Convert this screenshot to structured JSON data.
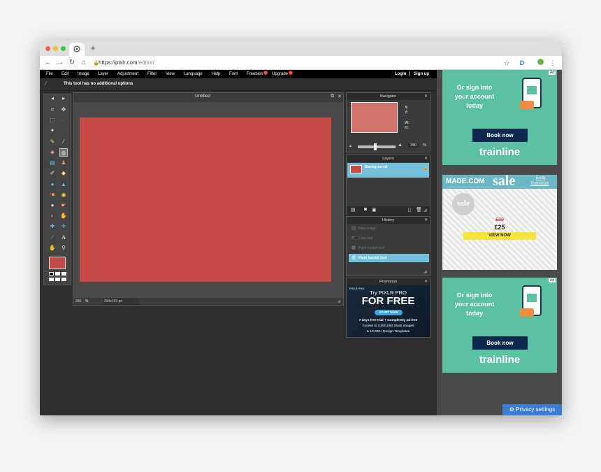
{
  "browser": {
    "url_host": "https://pixlr.com",
    "url_path": "/editor/",
    "new_tab_symbol": "+",
    "icons": [
      "back-icon",
      "forward-icon",
      "reload-icon",
      "home-icon",
      "lock-icon",
      "star-icon",
      "profile-icon",
      "menu-icon"
    ]
  },
  "menu": {
    "items": [
      "File",
      "Edit",
      "Image",
      "Layer",
      "Adjustment",
      "Filter",
      "View",
      "Language",
      "Help",
      "Font",
      "Freebies",
      "Upgrade"
    ],
    "freebies_badge": "1",
    "upgrade_badge": "1",
    "login": "Login",
    "signup": "Sign up",
    "separator": "|"
  },
  "options": {
    "message": "This tool has no additional options"
  },
  "document": {
    "title": "Untitled",
    "zoom": "280",
    "zoom_unit": "%",
    "size": "234x153 px",
    "canvas_color": "#c64a46"
  },
  "navigator": {
    "title": "Navigator",
    "x_label": "X:",
    "y_label": "Y:",
    "w_label": "W:",
    "h_label": "H:",
    "zoom": "280",
    "zoom_unit": "%"
  },
  "layers": {
    "title": "Layers",
    "items": [
      {
        "name": "Background"
      }
    ]
  },
  "history": {
    "title": "History",
    "items": [
      "New image",
      "Crop tool",
      "Paint bucket tool",
      "Paint bucket tool"
    ],
    "active_index": 3
  },
  "promotion": {
    "title": "Promotion",
    "brand": "PIXLR PRO",
    "line1": "Try PIXLR PRO",
    "line2": "FOR FREE",
    "button": "START NOW",
    "line3": "7 days free trial + Completely ad-free",
    "line4": "Access to 3,000,000 Stock Images",
    "line5": "& 10,000+ Design Templates"
  },
  "ads": {
    "trainline_top": {
      "text1": "Or sign into",
      "text2": "your account",
      "text3": "today",
      "button": "Book now",
      "brand": "trainline",
      "adchoice": "Ad"
    },
    "made": {
      "brand": "MADE.COM",
      "sale": "sale",
      "ends1": "Ends",
      "ends2": "Tomorrow",
      "badge": "sale",
      "old_price": "£39",
      "price": "£25",
      "cta": "VIEW NOW"
    },
    "trainline_bottom": {
      "text1": "Or sign into",
      "text2": "your account",
      "text3": "today",
      "button": "Book now",
      "brand": "trainline",
      "adchoice": "Ad"
    },
    "privacy": "Privacy settings"
  },
  "colors": {
    "accent_selected": "#76bfd8",
    "trainline_green": "#5cc0a2",
    "trainline_navy": "#0c2a4e"
  }
}
